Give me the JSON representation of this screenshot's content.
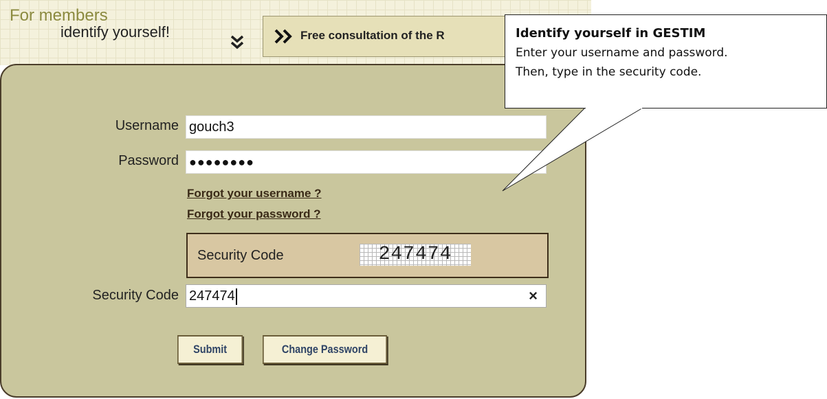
{
  "header": {
    "title": "For members",
    "subtitle": "identify yourself!",
    "consult_tab_label": "Free consultation of the R"
  },
  "form": {
    "username_label": "Username",
    "username_value": "gouch3",
    "password_label": "Password",
    "password_value": "●●●●●●●●",
    "forgot_username": "Forgot your username ?",
    "forgot_password": "Forgot your password ?",
    "security_box_label": "Security Code",
    "captcha_value": "247474",
    "security_code_label": "Security Code",
    "security_code_value": "247474",
    "clear_glyph": "×",
    "submit_label": "Submit",
    "change_password_label": "Change Password"
  },
  "callout": {
    "title": "Identify yourself in GESTIM",
    "line1": "Enter your username and password.",
    "line2": "Then, type in the security code."
  },
  "colors": {
    "panel": "#c9c69d",
    "header": "#f4f1dc",
    "title_olive": "#8b8a3f",
    "button_text": "#2f4466"
  }
}
